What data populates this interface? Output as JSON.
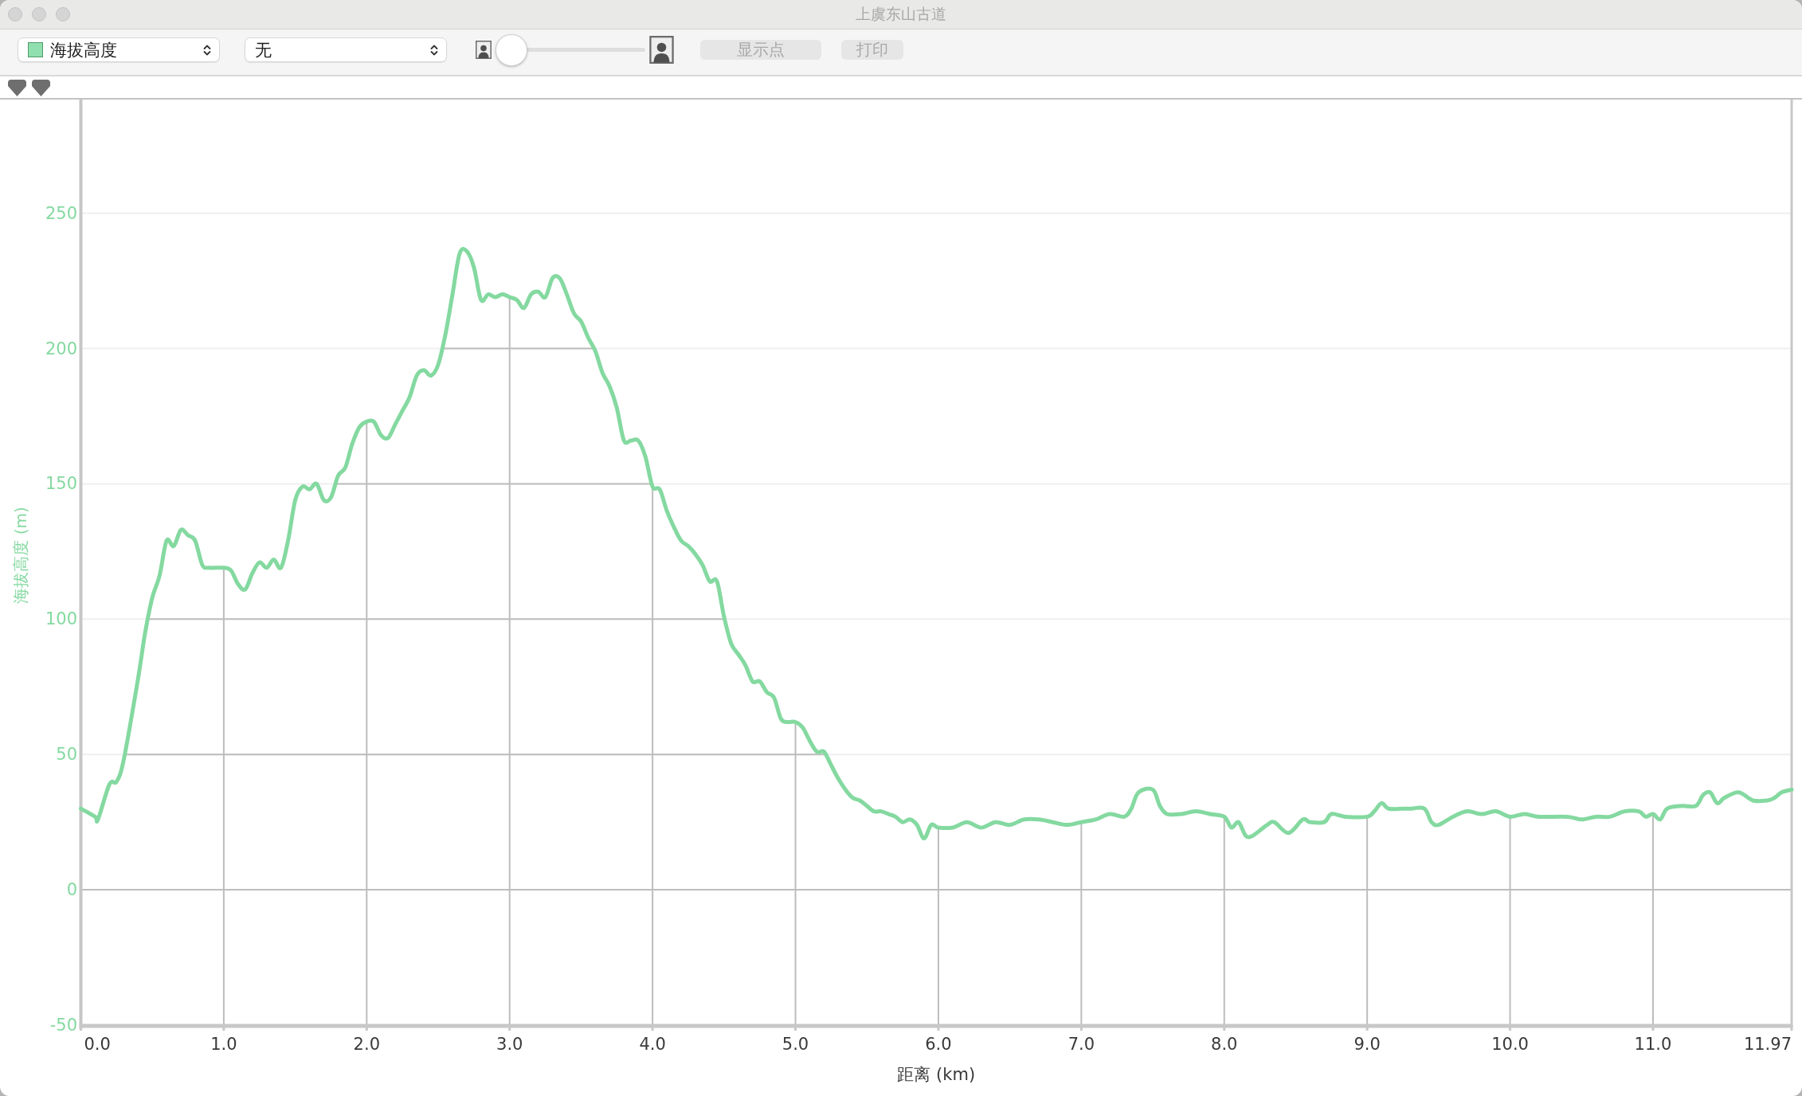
{
  "window": {
    "title": "上虞东山古道"
  },
  "toolbar": {
    "dropdowns": [
      {
        "value": "海拔高度",
        "color": "#8fe0ae"
      },
      {
        "value": "无"
      }
    ],
    "slider": {
      "level": 0
    },
    "buttons": [
      {
        "label": "显示点",
        "disabled": true
      },
      {
        "label": "打印",
        "disabled": true
      }
    ]
  },
  "chart": {
    "chart_data": {
      "type": "line",
      "xlabel": "距离 (km)",
      "ylabel": "海拔高度 (m)",
      "x": [
        0,
        0.1,
        0.12,
        0.2,
        0.25,
        0.3,
        0.4,
        0.45,
        0.5,
        0.55,
        0.6,
        0.65,
        0.7,
        0.75,
        0.8,
        0.85,
        0.9,
        1.0,
        1.05,
        1.1,
        1.15,
        1.2,
        1.25,
        1.3,
        1.35,
        1.4,
        1.45,
        1.5,
        1.55,
        1.6,
        1.65,
        1.7,
        1.75,
        1.8,
        1.85,
        1.9,
        1.95,
        2.0,
        2.05,
        2.1,
        2.15,
        2.2,
        2.25,
        2.3,
        2.35,
        2.4,
        2.45,
        2.5,
        2.55,
        2.6,
        2.65,
        2.7,
        2.75,
        2.8,
        2.85,
        2.9,
        2.95,
        3.0,
        3.05,
        3.1,
        3.15,
        3.2,
        3.25,
        3.3,
        3.35,
        3.4,
        3.45,
        3.5,
        3.55,
        3.6,
        3.65,
        3.7,
        3.75,
        3.8,
        3.85,
        3.9,
        3.95,
        4.0,
        4.05,
        4.1,
        4.15,
        4.2,
        4.25,
        4.3,
        4.35,
        4.4,
        4.45,
        4.5,
        4.55,
        4.6,
        4.65,
        4.7,
        4.75,
        4.8,
        4.85,
        4.9,
        4.95,
        5.0,
        5.05,
        5.1,
        5.15,
        5.2,
        5.25,
        5.3,
        5.35,
        5.4,
        5.45,
        5.5,
        5.55,
        5.6,
        5.65,
        5.7,
        5.75,
        5.8,
        5.85,
        5.9,
        5.95,
        6.0,
        6.1,
        6.2,
        6.3,
        6.4,
        6.5,
        6.6,
        6.7,
        6.8,
        6.9,
        7.0,
        7.1,
        7.2,
        7.3,
        7.35,
        7.4,
        7.5,
        7.55,
        7.6,
        7.7,
        7.8,
        7.9,
        8.0,
        8.05,
        8.1,
        8.15,
        8.2,
        8.3,
        8.35,
        8.45,
        8.55,
        8.6,
        8.7,
        8.75,
        8.85,
        9.0,
        9.05,
        9.1,
        9.15,
        9.25,
        9.3,
        9.4,
        9.45,
        9.5,
        9.6,
        9.7,
        9.8,
        9.9,
        10.0,
        10.1,
        10.2,
        10.4,
        10.5,
        10.6,
        10.7,
        10.8,
        10.9,
        10.95,
        11.0,
        11.05,
        11.1,
        11.2,
        11.3,
        11.35,
        11.4,
        11.45,
        11.5,
        11.6,
        11.7,
        11.8,
        11.85,
        11.9,
        11.97
      ],
      "series": [
        {
          "color": "#84d9a0",
          "values": [
            30,
            27,
            26,
            39,
            40,
            48,
            78,
            95,
            108,
            116,
            129,
            127,
            133,
            131,
            129,
            120,
            119,
            119,
            118,
            113,
            111,
            117,
            121,
            119,
            122,
            119,
            129,
            144,
            149,
            148,
            150,
            144,
            145,
            153,
            156,
            165,
            171,
            173,
            173,
            168,
            167,
            172,
            177,
            182,
            190,
            192,
            190,
            194,
            205,
            220,
            235,
            236,
            230,
            218,
            220,
            219,
            220,
            219,
            218,
            215,
            220,
            221,
            219,
            226,
            226,
            220,
            213,
            210,
            204,
            199,
            191,
            186,
            178,
            166,
            166,
            166,
            160,
            149,
            148,
            140,
            134,
            129,
            127,
            124,
            120,
            114,
            114,
            101,
            91,
            87,
            83,
            77,
            77,
            73,
            71,
            63,
            62,
            62,
            60,
            55,
            51,
            51,
            46,
            41,
            37,
            34,
            33,
            31,
            29,
            29,
            28,
            27,
            25,
            26,
            24,
            19,
            24,
            23,
            23,
            25,
            23,
            25,
            24,
            26,
            26,
            25,
            24,
            25,
            26,
            28,
            27,
            30,
            36,
            37,
            31,
            28,
            28,
            29,
            28,
            27,
            23,
            25,
            20,
            20,
            24,
            25,
            21,
            26,
            25,
            25,
            28,
            27,
            27,
            29,
            32,
            30,
            30,
            30,
            30,
            25,
            24,
            27,
            29,
            28,
            29,
            27,
            28,
            27,
            27,
            26,
            27,
            27,
            29,
            29,
            27,
            28,
            26,
            30,
            31,
            31,
            35,
            36,
            32,
            34,
            36,
            33,
            33,
            34,
            36,
            37
          ]
        }
      ],
      "xlim": [
        0,
        11.97
      ],
      "ylim": [
        -50,
        292
      ],
      "xticks": [
        {
          "value": 0,
          "label": "0.0"
        },
        {
          "value": 1,
          "label": "1.0"
        },
        {
          "value": 2,
          "label": "2.0"
        },
        {
          "value": 3,
          "label": "3.0"
        },
        {
          "value": 4,
          "label": "4.0"
        },
        {
          "value": 5,
          "label": "5.0"
        },
        {
          "value": 6,
          "label": "6.0"
        },
        {
          "value": 7,
          "label": "7.0"
        },
        {
          "value": 8,
          "label": "8.0"
        },
        {
          "value": 9,
          "label": "9.0"
        },
        {
          "value": 10,
          "label": "10.0"
        },
        {
          "value": 11,
          "label": "11.0"
        },
        {
          "value": 11.97,
          "label": "11.97"
        }
      ],
      "yticks": [
        -50,
        0,
        50,
        100,
        150,
        200,
        250
      ],
      "grid": true
    }
  }
}
